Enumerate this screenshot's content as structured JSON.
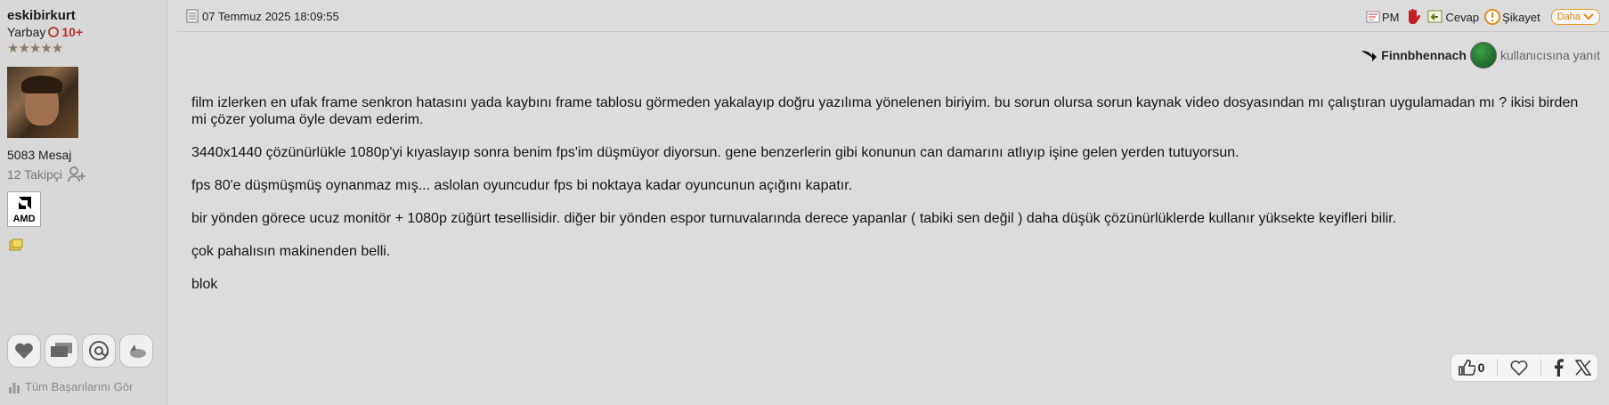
{
  "user": {
    "username": "eskibirkurt",
    "rank": "Yarbay",
    "level": "10+",
    "stars": "★★★★★",
    "message_count": "5083 Mesaj",
    "followers": "12 Takipçi",
    "badge_text": "AMD",
    "achievements_link": "Tüm Başarılarını Gör"
  },
  "post": {
    "date": "07 Temmuz 2025 18:09:55",
    "toolbar": {
      "pm": "PM",
      "reply": "Cevap",
      "report": "Şikayet",
      "more": "Daha"
    },
    "reply_to": {
      "name": "Finnbhennach",
      "suffix": "kullanıcısına yanıt"
    },
    "paragraphs": [
      "film izlerken en ufak frame senkron hatasını yada kaybını frame tablosu görmeden yakalayıp doğru yazılıma yönelenen biriyim. bu sorun olursa sorun kaynak video dosyasından mı çalıştıran uygulamadan mı ? ikisi birden mi çözer yoluma öyle devam ederim.",
      "3440x1440 çözünürlükle 1080p'yi kıyaslayıp sonra benim fps'im düşmüyor diyorsun. gene benzerlerin gibi konunun can damarını atlıyıp işine gelen yerden tutuyorsun.",
      "fps 80'e düşmüşmüş oynanmaz mış... aslolan oyuncudur fps bi noktaya kadar oyuncunun açığını kapatır.",
      "bir yönden görece ucuz monitör + 1080p züğürt tesellisidir. diğer bir yönden espor turnuvalarında derece yapanlar ( tabiki sen değil ) daha düşük çözünürlüklerde kullanır yüksekte keyifleri bilir.",
      "çok pahalısın makinenden belli.",
      "blok"
    ],
    "like_count": "0"
  },
  "colors": {
    "background": "#dcdcdc",
    "accent_orange": "#e08a1a",
    "level_red": "#b03030"
  },
  "icons": [
    "date-icon",
    "pm-icon",
    "hand-icon",
    "reply-icon",
    "report-icon",
    "chevron-down-icon",
    "reply-arrow-icon",
    "follow-icon",
    "amd-arrow-icon",
    "heart-icon",
    "chat-icon",
    "mention-icon",
    "cloud-icon",
    "chart-icon",
    "thumbs-up-icon",
    "facebook-icon",
    "x-icon"
  ]
}
